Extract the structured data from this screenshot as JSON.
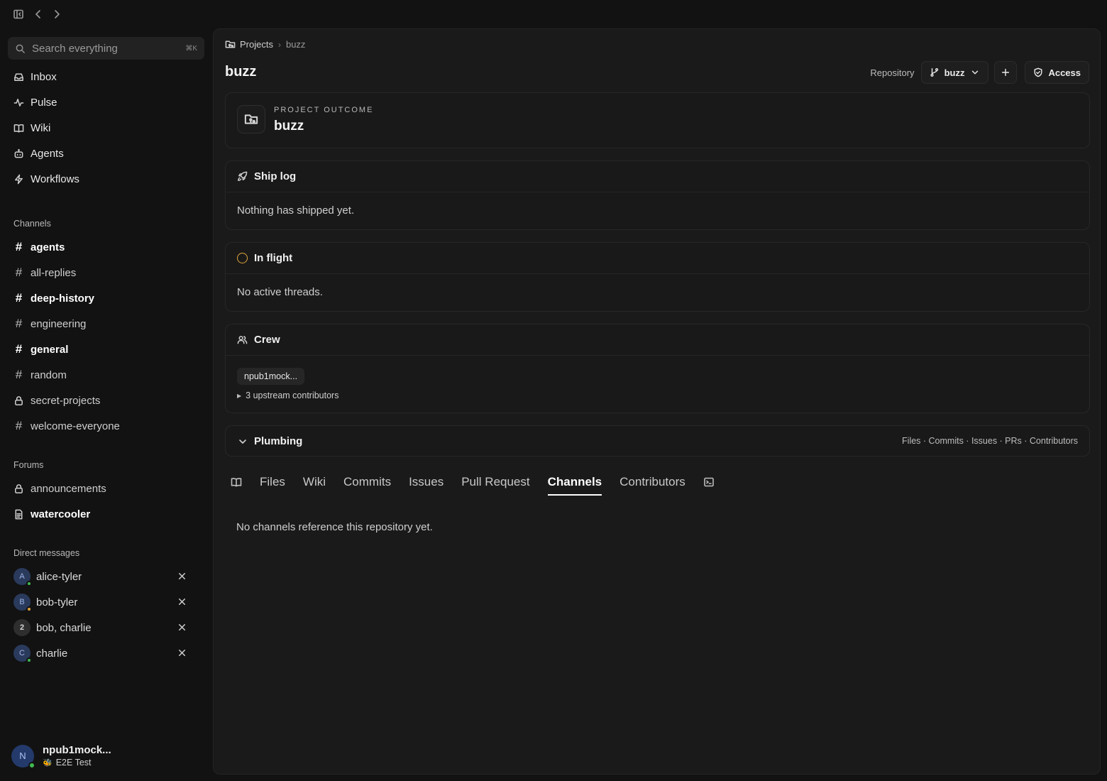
{
  "sidebar": {
    "search": {
      "placeholder": "Search everything",
      "shortcut": "⌘K"
    },
    "nav": [
      {
        "label": "Inbox",
        "icon": "inbox-icon"
      },
      {
        "label": "Pulse",
        "icon": "pulse-icon"
      },
      {
        "label": "Wiki",
        "icon": "book-icon"
      },
      {
        "label": "Agents",
        "icon": "bot-icon"
      },
      {
        "label": "Workflows",
        "icon": "lightning-icon"
      }
    ],
    "channels_label": "Channels",
    "channels": [
      {
        "label": "agents",
        "bold": true
      },
      {
        "label": "all-replies",
        "bold": false
      },
      {
        "label": "deep-history",
        "bold": true
      },
      {
        "label": "engineering",
        "bold": false
      },
      {
        "label": "general",
        "bold": true
      },
      {
        "label": "random",
        "bold": false
      },
      {
        "label": "secret-projects",
        "bold": false,
        "locked": true
      },
      {
        "label": "welcome-everyone",
        "bold": false
      }
    ],
    "forums_label": "Forums",
    "forums": [
      {
        "label": "announcements",
        "icon": "lock-icon"
      },
      {
        "label": "watercooler",
        "icon": "document-icon"
      }
    ],
    "dm_label": "Direct messages",
    "dms": [
      {
        "label": "alice-tyler",
        "initial": "A",
        "status": "online"
      },
      {
        "label": "bob-tyler",
        "initial": "B",
        "status": "away"
      },
      {
        "label": "bob, charlie",
        "initial": "2",
        "status": ""
      },
      {
        "label": "charlie",
        "initial": "C",
        "status": "online"
      }
    ],
    "user": {
      "name": "npub1mock...",
      "initial": "N",
      "status_text": "E2E Test",
      "status_emoji": "🐝"
    }
  },
  "main": {
    "breadcrumb": {
      "root": "Projects",
      "current": "buzz"
    },
    "title": "buzz",
    "header": {
      "repository_label": "Repository",
      "branch": "buzz",
      "access_label": "Access"
    },
    "outcome": {
      "kicker": "PROJECT OUTCOME",
      "title": "buzz"
    },
    "shiplog": {
      "title": "Ship log",
      "body": "Nothing has shipped yet."
    },
    "inflight": {
      "title": "In flight",
      "body": "No active threads."
    },
    "crew": {
      "title": "Crew",
      "chip": "npub1mock...",
      "upstream": "3 upstream contributors"
    },
    "plumbing": {
      "title": "Plumbing",
      "links": "Files · Commits · Issues · PRs · Contributors"
    },
    "tabs": [
      "Files",
      "Wiki",
      "Commits",
      "Issues",
      "Pull Request",
      "Channels",
      "Contributors"
    ],
    "active_tab": "Channels",
    "empty_message": "No channels reference this repository yet."
  },
  "colors": {
    "accent_inflight": "#e0a43b",
    "status_online": "#3fb950",
    "status_away": "#e3a33a"
  }
}
